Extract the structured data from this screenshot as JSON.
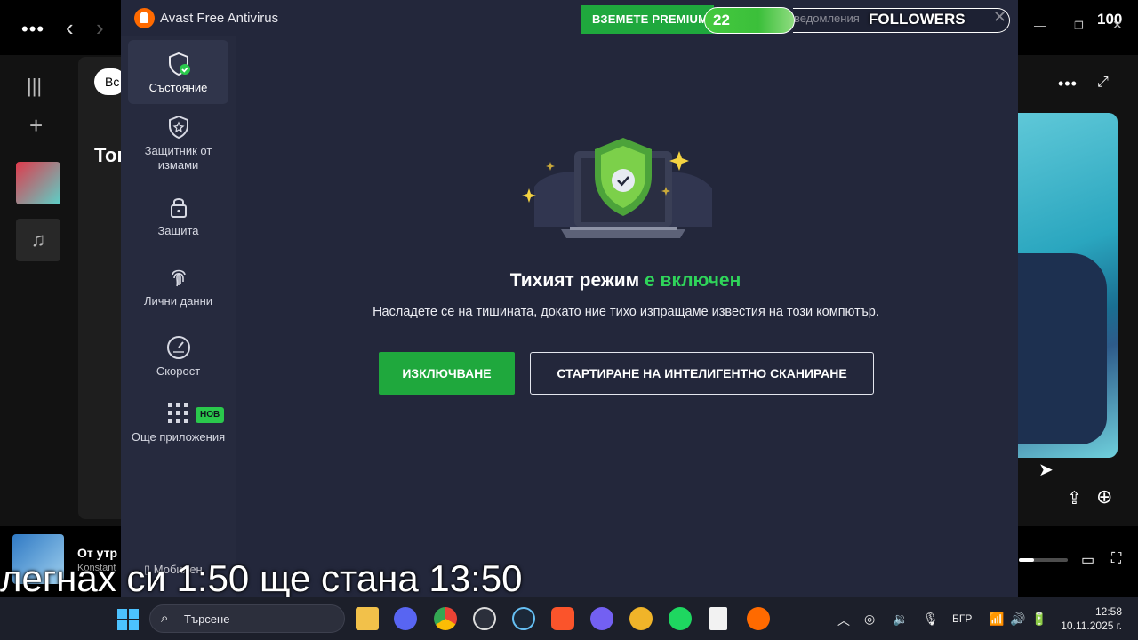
{
  "spotify": {
    "filter_pill": "Вс",
    "section_title": "Топ",
    "now_playing": {
      "title": "От утр",
      "artist": "Konstant"
    },
    "volume_fraction": 0.3
  },
  "avast": {
    "title": "Avast Free Antivirus",
    "premium_label": "ВЗЕМЕТЕ PREMIUM",
    "notifications_label": "ведомления",
    "nav": [
      {
        "label": "Състояние",
        "icon": "shield-check-icon",
        "active": true
      },
      {
        "label": "Защитник от измами",
        "icon": "shield-star-icon",
        "active": false
      },
      {
        "label": "Защита",
        "icon": "lock-icon",
        "active": false
      },
      {
        "label": "Лични данни",
        "icon": "fingerprint-icon",
        "active": false
      },
      {
        "label": "Скорост",
        "icon": "speedometer-icon",
        "active": false
      },
      {
        "label": "Още приложения",
        "icon": "grid-icon",
        "active": false,
        "badge": "НОВ"
      }
    ],
    "mobile_label": "Мобилен",
    "headline_prefix": "Тихият режим",
    "headline_status": "е включен",
    "description": "Насладете се на тишината, докато ние тихо изпращаме известия на този компютър.",
    "btn_turn_off": "ИЗКЛЮЧВАНЕ",
    "btn_smart_scan": "СТАРТИРАНЕ НА ИНТЕЛИГЕНТНО СКАНИРАНЕ",
    "accent_green": "#1fa83d",
    "status_green": "#2fd45a"
  },
  "overlay": {
    "counter": "22",
    "followers_label": "FOLLOWERS",
    "followers_goal": "100",
    "caption": "легнах си 1:50 ще стана 13:50"
  },
  "taskbar": {
    "search_placeholder": "Търсене",
    "language": "БГР",
    "time": "12:58",
    "date": "10.11.2025 г."
  }
}
